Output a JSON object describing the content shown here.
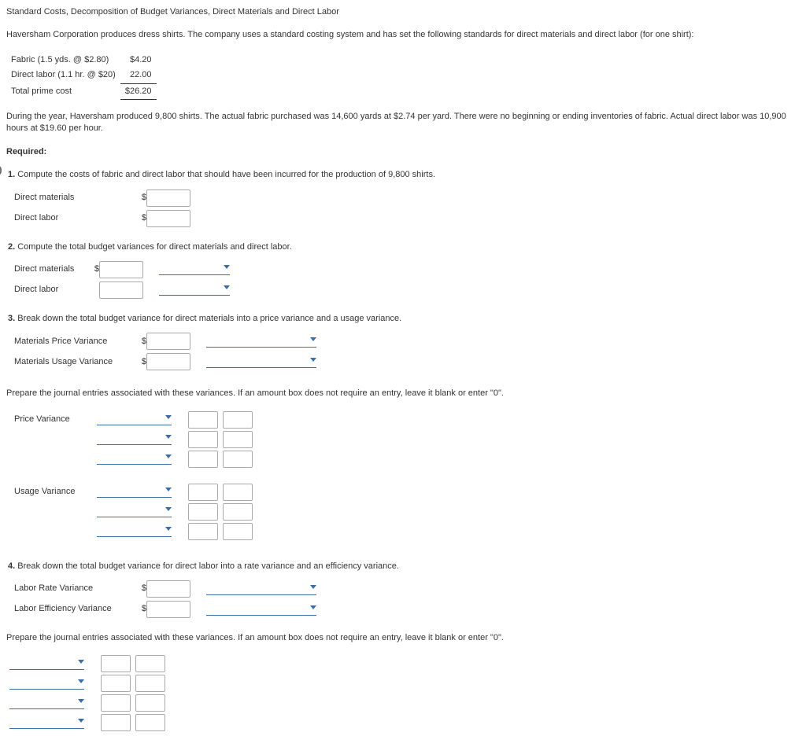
{
  "title": "Standard Costs, Decomposition of Budget Variances, Direct Materials and Direct Labor",
  "intro": "Haversham Corporation produces dress shirts. The company uses a standard costing system and has set the following standards for direct materials and direct labor (for one shirt):",
  "cost": {
    "fabric_label": "Fabric (1.5 yds. @ $2.80)",
    "fabric_amt": "$4.20",
    "labor_label": "Direct labor (1.1 hr. @ $20)",
    "labor_amt": "22.00",
    "total_label": "Total prime cost",
    "total_amt": "$26.20"
  },
  "narrative": "During the year, Haversham produced 9,800 shirts. The actual fabric purchased was 14,600 yards at $2.74 per yard. There were no beginning or ending inventories of fabric. Actual direct labor was 10,900 hours at $19.60 per hour.",
  "required_label": "Required:",
  "q1": {
    "num": "1.",
    "text": " Compute the costs of fabric and direct labor that should have been incurred for the production of 9,800 shirts.",
    "dm": "Direct materials",
    "dl": "Direct labor"
  },
  "q2": {
    "num": "2.",
    "text": " Compute the total budget variances for direct materials and direct labor.",
    "dm": "Direct materials",
    "dl": "Direct labor"
  },
  "q3": {
    "num": "3.",
    "text": " Break down the total budget variance for direct materials into a price variance and a usage variance.",
    "mpv": "Materials Price Variance",
    "muv": "Materials Usage Variance"
  },
  "je_intro": "Prepare the journal entries associated with these variances. If an amount box does not require an entry, leave it blank or enter \"0\".",
  "je_pv": "Price Variance",
  "je_uv": "Usage Variance",
  "q4": {
    "num": "4.",
    "text": " Break down the total budget variance for direct labor into a rate variance and an efficiency variance.",
    "lrv": "Labor Rate Variance",
    "lev": "Labor Efficiency Variance"
  },
  "dollar": "$"
}
